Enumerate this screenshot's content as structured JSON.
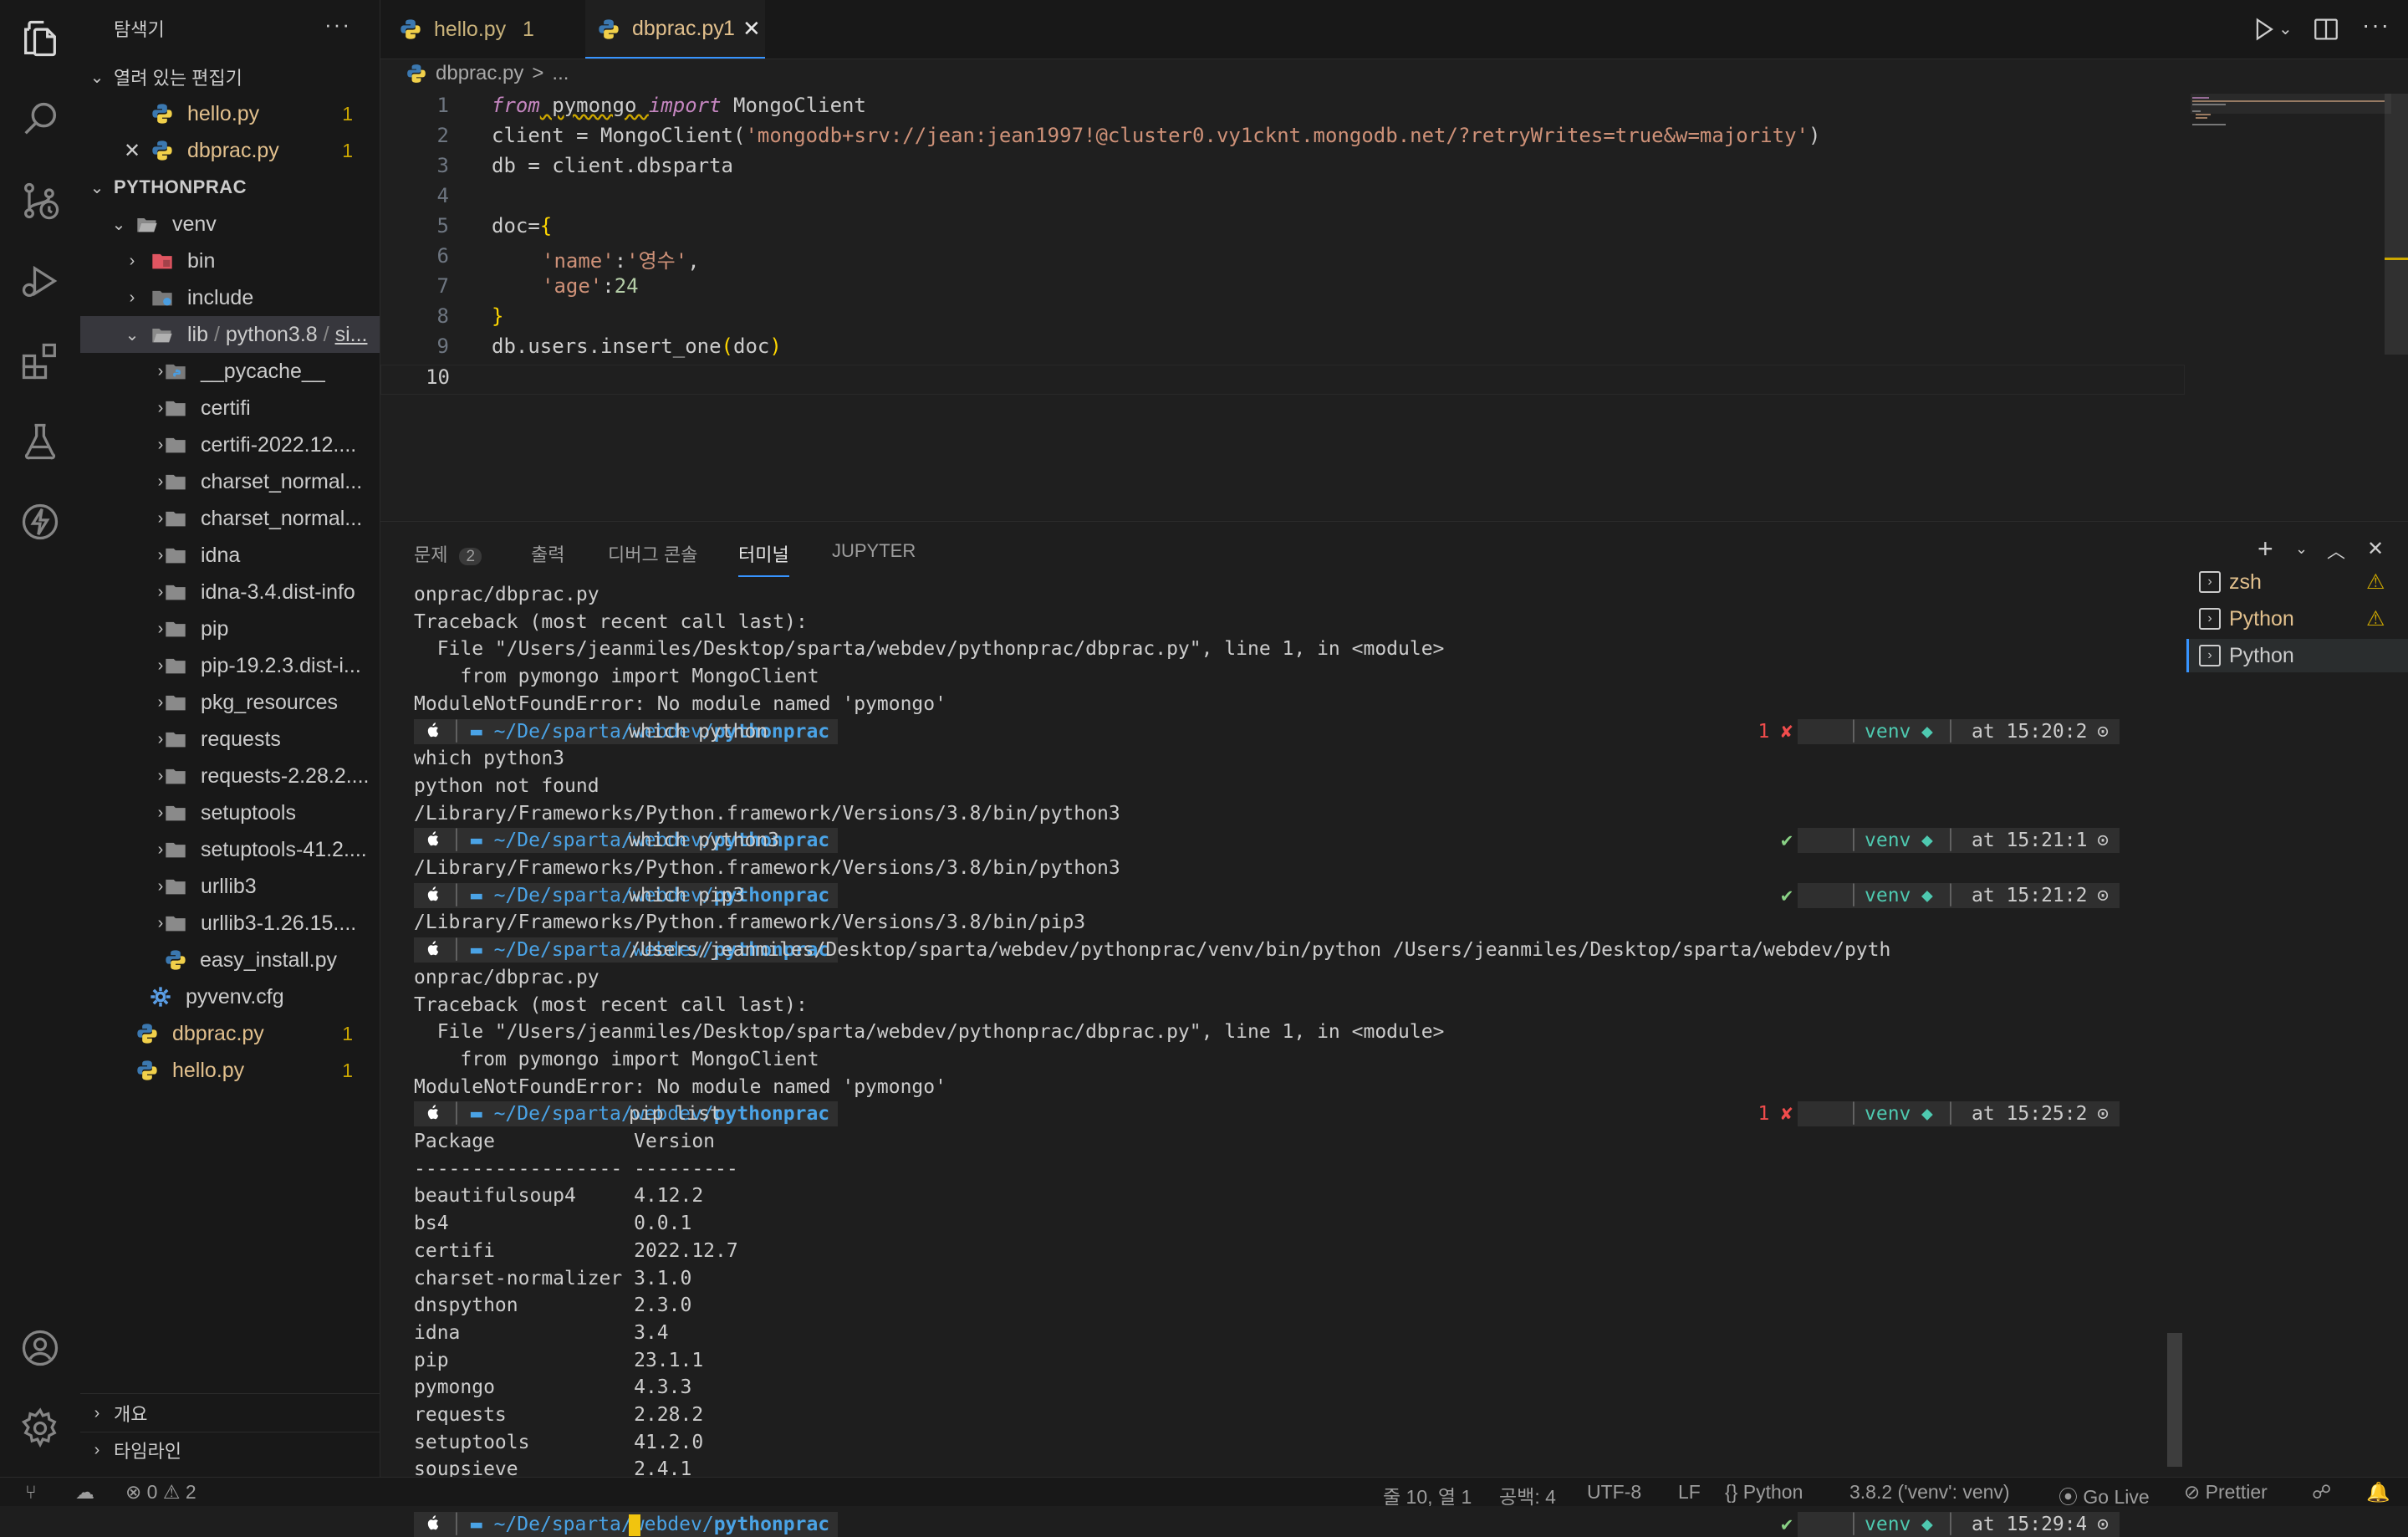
{
  "explorer": {
    "title": "탐색기",
    "open_editors_label": "열려 있는 편집기",
    "open_editors": [
      {
        "name": "hello.py",
        "badge": "1"
      },
      {
        "name": "dbprac.py",
        "badge": "1"
      }
    ],
    "project_label": "PYTHONPRAC",
    "tree": {
      "venv": "venv",
      "bin": "bin",
      "include": "include",
      "lib": "lib",
      "lib_sep1": "/",
      "python": "python3.8",
      "lib_sep2": "/",
      "site": "si...",
      "folders": [
        "__pycache__",
        "certifi",
        "certifi-2022.12....",
        "charset_normal...",
        "charset_normal...",
        "idna",
        "idna-3.4.dist-info",
        "pip",
        "pip-19.2.3.dist-i...",
        "pkg_resources",
        "requests",
        "requests-2.28.2....",
        "setuptools",
        "setuptools-41.2....",
        "urllib3",
        "urllib3-1.26.15...."
      ],
      "easy_install": "easy_install.py",
      "pyvenv": "pyvenv.cfg",
      "dbprac": "dbprac.py",
      "dbprac_badge": "1",
      "hello": "hello.py",
      "hello_badge": "1"
    },
    "outline_label": "개요",
    "timeline_label": "타임라인"
  },
  "tabs": [
    {
      "name": "hello.py",
      "badge": "1"
    },
    {
      "name": "dbprac.py",
      "badge": "1"
    }
  ],
  "breadcrumb": {
    "file": "dbprac.py",
    "sep": ">",
    "rest": "..."
  },
  "code": {
    "line_numbers": [
      "1",
      "2",
      "3",
      "4",
      "5",
      "6",
      "7",
      "8",
      "9",
      "10"
    ],
    "l1_from": "from",
    "l1_mod": " pymongo ",
    "l1_import": "import",
    "l1_rest": " MongoClient",
    "l2_pre": "client = MongoClient(",
    "l2_str": "'mongodb+srv://jean:jean1997!@cluster0.vy1cknt.mongodb.net/?retryWrites=true&w=majority'",
    "l2_post": ")",
    "l3": "db = client.dbsparta",
    "l5_pre": "doc=",
    "l5_brace": "{",
    "l6_key": "'name'",
    "l6_colon": ":",
    "l6_val": "'영수'",
    "l6_comma": ",",
    "l7_key": "'age'",
    "l7_colon": ":",
    "l7_val": "24",
    "l8": "}",
    "l9_pre": "db.users.insert_one",
    "l9_open": "(",
    "l9_arg": "doc",
    "l9_close": ")"
  },
  "panel": {
    "tabs": {
      "problems": "문제",
      "problems_count": "2",
      "output": "출력",
      "debug": "디버그 콘솔",
      "terminal": "터미널",
      "jupyter": "JUPYTER"
    },
    "terminals": [
      "zsh",
      "Python",
      "Python"
    ]
  },
  "terminal": {
    "path_pre": "~/De/sparta/webdev/",
    "path_bold": "pythonprac",
    "lines_a": [
      "onprac/dbprac.py",
      "Traceback (most recent call last):",
      "  File \"/Users/jeanmiles/Desktop/sparta/webdev/pythonprac/dbprac.py\", line 1, in <module>",
      "    from pymongo import MongoClient",
      "ModuleNotFoundError: No module named 'pymongo'"
    ],
    "p1_cmd": "which python",
    "p1_status": "1 ✘",
    "p1_time": "at 15:20:26",
    "lines_b": [
      "which python3",
      "python not found",
      "/Library/Frameworks/Python.framework/Versions/3.8/bin/python3"
    ],
    "p2_cmd": "which python3",
    "p2_status": "✔",
    "p2_time": "at 15:21:13",
    "line_c": "/Library/Frameworks/Python.framework/Versions/3.8/bin/python3",
    "p3_cmd": "which pip3",
    "p3_status": "✔",
    "p3_time": "at 15:21:23",
    "line_d": "/Library/Frameworks/Python.framework/Versions/3.8/bin/pip3",
    "p4_cmd": "/Users/jeanmiles/Desktop/sparta/webdev/pythonprac/venv/bin/python /Users/jeanmiles/Desktop/sparta/webdev/pyth",
    "lines_e": [
      "onprac/dbprac.py",
      "Traceback (most recent call last):",
      "  File \"/Users/jeanmiles/Desktop/sparta/webdev/pythonprac/dbprac.py\", line 1, in <module>",
      "    from pymongo import MongoClient",
      "ModuleNotFoundError: No module named 'pymongo'"
    ],
    "p5_cmd": "pip list",
    "p5_status": "1 ✘",
    "p5_time": "at 15:25:20",
    "pip_header": "Package            Version",
    "pip_rule": "------------------ ---------",
    "packages": [
      "beautifulsoup4     4.12.2",
      "bs4                0.0.1",
      "certifi            2022.12.7",
      "charset-normalizer 3.1.0",
      "dnspython          2.3.0",
      "idna               3.4",
      "pip                23.1.1",
      "pymongo            4.3.3",
      "requests           2.28.2",
      "setuptools         41.2.0",
      "soupsieve          2.4.1",
      "urllib3            1.26.15"
    ],
    "p6_status": "✔",
    "p6_time": "at 15:29:46",
    "venv": "venv"
  },
  "status": {
    "errors": "0",
    "warnings": "2",
    "cursor": "줄 10, 열 1",
    "spaces": "공백: 4",
    "encoding": "UTF-8",
    "eol": "LF",
    "language": "Python",
    "interpreter": "3.8.2 ('venv': venv)",
    "golive": "Go Live",
    "prettier": "Prettier"
  }
}
